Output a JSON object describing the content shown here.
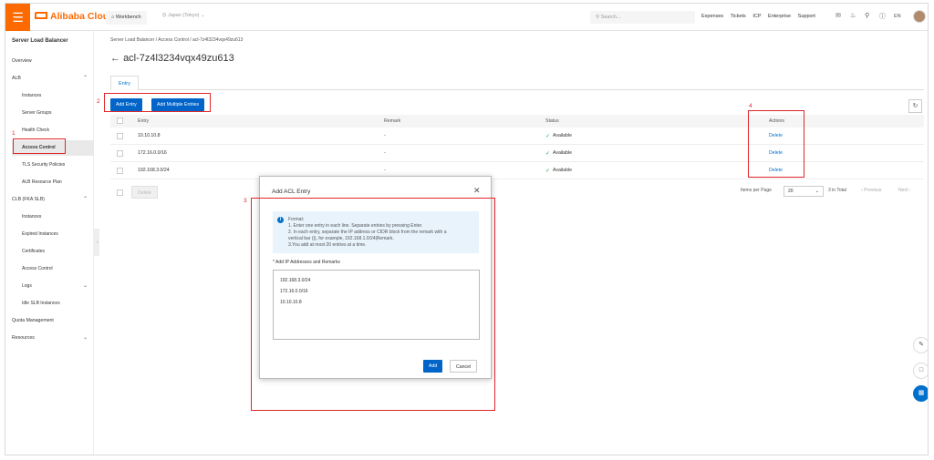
{
  "topbar": {
    "logo_text": "Alibaba Cloud",
    "workbench": "Workbench",
    "region": "Japan (Tokyo)",
    "search_placeholder": "Search...",
    "nav": [
      "Expenses",
      "Tickets",
      "ICP",
      "Enterprise",
      "Support"
    ],
    "language": "EN"
  },
  "sidebar": {
    "title": "Server Load Balancer",
    "overview": "Overview",
    "alb": "ALB",
    "alb_items": [
      "Instances",
      "Server Groups",
      "Health Check",
      "Access Control",
      "TLS Security Policies",
      "ALB Resource Plan"
    ],
    "clb": "CLB (FKA SLB)",
    "clb_items": [
      "Instances",
      "Expired Instances",
      "Certificates",
      "Access Control",
      "Logs",
      "Idle SLB Instances"
    ],
    "quota": "Quota Management",
    "resources": "Resources"
  },
  "main": {
    "breadcrumb": "Server Load Balancer  /  Access Control  /  acl-7z4l3234vqx49zu613",
    "title": "acl-7z4l3234vqx49zu613",
    "tab": "Entry",
    "add_entry": "Add Entry",
    "add_multiple": "Add Multiple Entries",
    "columns": [
      "Entry",
      "Remark",
      "Status",
      "Actions"
    ],
    "rows": [
      {
        "entry": "10.10.10.8",
        "remark": "-",
        "status": "Available",
        "action": "Delete"
      },
      {
        "entry": "172.16.0.0/16",
        "remark": "-",
        "status": "Available",
        "action": "Delete"
      },
      {
        "entry": "192.168.3.0/24",
        "remark": "-",
        "status": "Available",
        "action": "Delete"
      }
    ],
    "delete_bulk": "Delete",
    "items_per_page_label": "Items per Page",
    "items_per_page": "20",
    "total": "3 in Total",
    "previous": "Previous",
    "next": "Next"
  },
  "dialog": {
    "title": "Add ACL Entry",
    "info": [
      "Format:",
      "1. Enter one entry in each line. Separate entries by pressing Enter.",
      "2. In each entry, separate the IP address or CIDR block from the remark with a",
      "vertical bar (|), for example, 192.168.1.0/24|Remark.",
      "3.You add at most 20 entries at a time."
    ],
    "field_label": "* Add IP Addresses and Remarks",
    "textarea_lines": [
      "192.168.3.0/24",
      "172.16.0.0/16",
      "10.10.10.8"
    ],
    "add": "Add",
    "cancel": "Cancel"
  },
  "annotations": {
    "one": "1",
    "two": "2",
    "three": "3",
    "four": "4"
  },
  "colors": {
    "brand": "#ff6a00",
    "primary": "#0064c8",
    "annotation": "#e0262b",
    "success": "#1e9e3a"
  }
}
